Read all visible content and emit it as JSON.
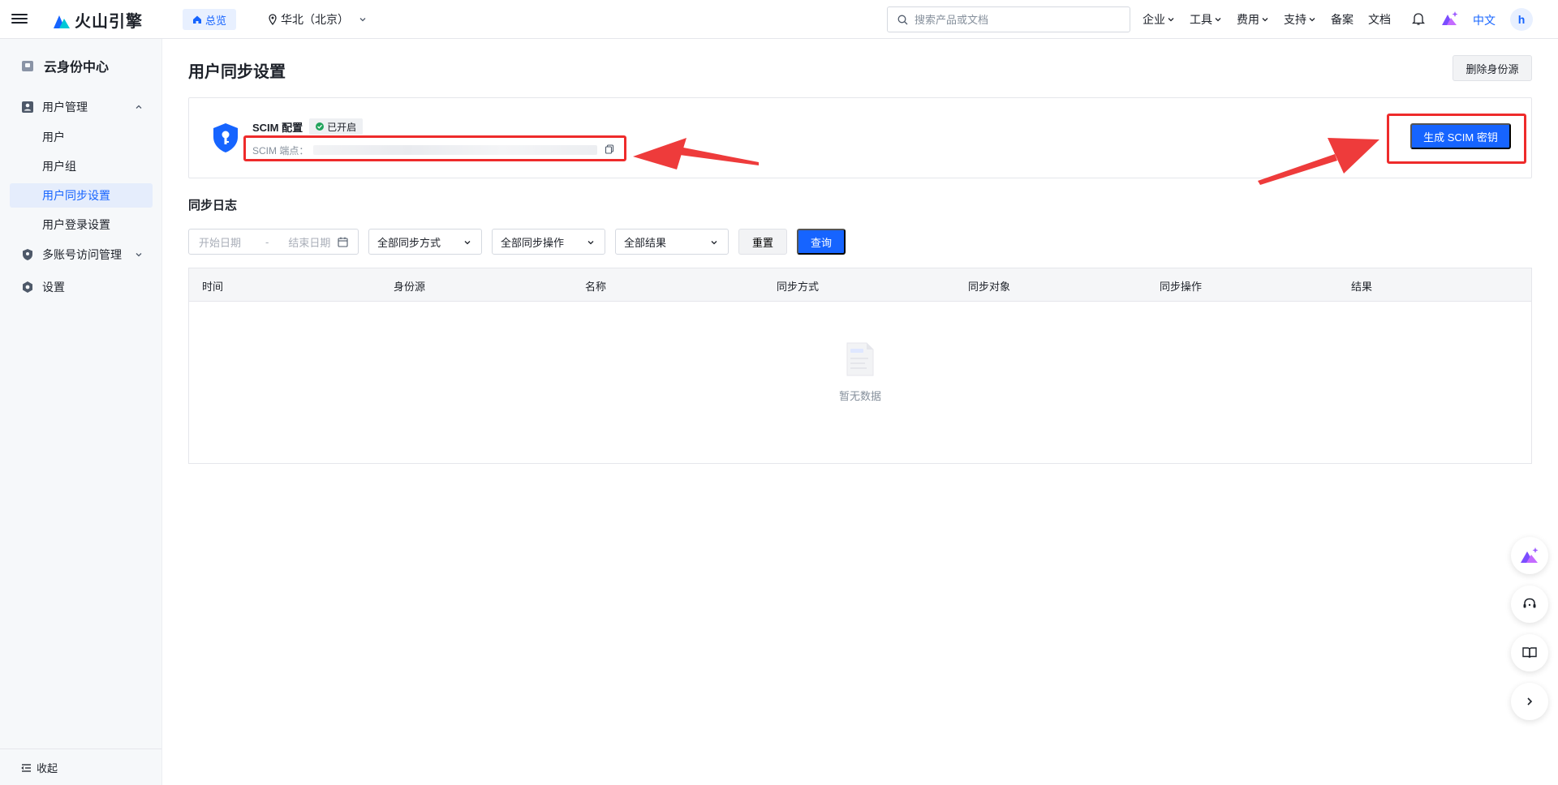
{
  "topbar": {
    "brand": "火山引擎",
    "home_label": "总览",
    "region": "华北（北京）",
    "search_placeholder": "搜索产品或文档",
    "nav": [
      {
        "label": "企业"
      },
      {
        "label": "工具"
      },
      {
        "label": "费用"
      },
      {
        "label": "支持"
      },
      {
        "label": "备案"
      },
      {
        "label": "文档"
      }
    ],
    "language": "中文",
    "avatar_initial": "h"
  },
  "sidebar": {
    "title": "云身份中心",
    "groups": {
      "user_mgmt": "用户管理",
      "multi_account": "多账号访问管理",
      "settings": "设置"
    },
    "items": {
      "users": "用户",
      "user_groups": "用户组",
      "user_sync": "用户同步设置",
      "user_login": "用户登录设置"
    },
    "collapse_label": "收起"
  },
  "main": {
    "title": "用户同步设置",
    "delete_source_label": "删除身份源",
    "scim": {
      "label": "SCIM 配置",
      "status": "已开启",
      "endpoint_label": "SCIM 端点：",
      "generate_key_label": "生成 SCIM 密钥"
    },
    "sync_log": {
      "title": "同步日志",
      "start_date_placeholder": "开始日期",
      "date_separator": "-",
      "end_date_placeholder": "结束日期",
      "filter_method": "全部同步方式",
      "filter_operation": "全部同步操作",
      "filter_result": "全部结果",
      "reset_label": "重置",
      "query_label": "查询",
      "columns": [
        "时间",
        "身份源",
        "名称",
        "同步方式",
        "同步对象",
        "同步操作",
        "结果"
      ],
      "empty_text": "暂无数据"
    }
  },
  "colors": {
    "primary": "#1664ff",
    "highlight": "#ee2b2b",
    "status_green": "#21a35c"
  }
}
